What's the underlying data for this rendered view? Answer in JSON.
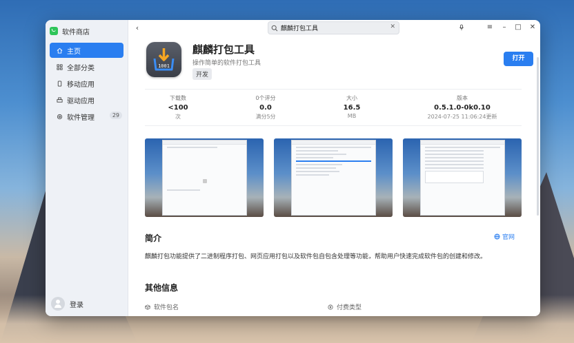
{
  "sidebar": {
    "app_title": "软件商店",
    "items": [
      {
        "label": "主页",
        "icon": "home-icon",
        "active": true
      },
      {
        "label": "全部分类",
        "icon": "grid-icon",
        "active": false
      },
      {
        "label": "移动应用",
        "icon": "phone-icon",
        "active": false
      },
      {
        "label": "驱动应用",
        "icon": "printer-icon",
        "active": false
      },
      {
        "label": "软件管理",
        "icon": "gear-icon",
        "active": false,
        "badge": "29"
      }
    ],
    "login_label": "登录"
  },
  "search": {
    "value": "麒麟打包工具"
  },
  "app": {
    "name": "麒麟打包工具",
    "description": "操作简单的软件打包工具",
    "tag": "开发",
    "open_label": "打开",
    "icon_text": "1001"
  },
  "stats": [
    {
      "label": "下载数",
      "value": "<100",
      "sub": "次"
    },
    {
      "label": "0个评分",
      "value": "0.0",
      "sub": "满分5分"
    },
    {
      "label": "大小",
      "value": "16.5",
      "sub": "MB"
    },
    {
      "label": "版本",
      "value": "0.5.1.0-0k0.10",
      "sub": "2024-07-25 11:06:24更新"
    }
  ],
  "intro": {
    "title": "简介",
    "official_label": "官网",
    "text": "麒麟打包功能提供了二进制程序打包、网页应用打包以及软件包自包含处理等功能，帮助用户快速完成软件包的创建和修改。"
  },
  "other_info": {
    "title": "其他信息",
    "package_name_label": "软件包名",
    "payment_type_label": "付费类型"
  },
  "colors": {
    "accent": "#2a7ef0",
    "logo_green": "#2fc55a"
  }
}
